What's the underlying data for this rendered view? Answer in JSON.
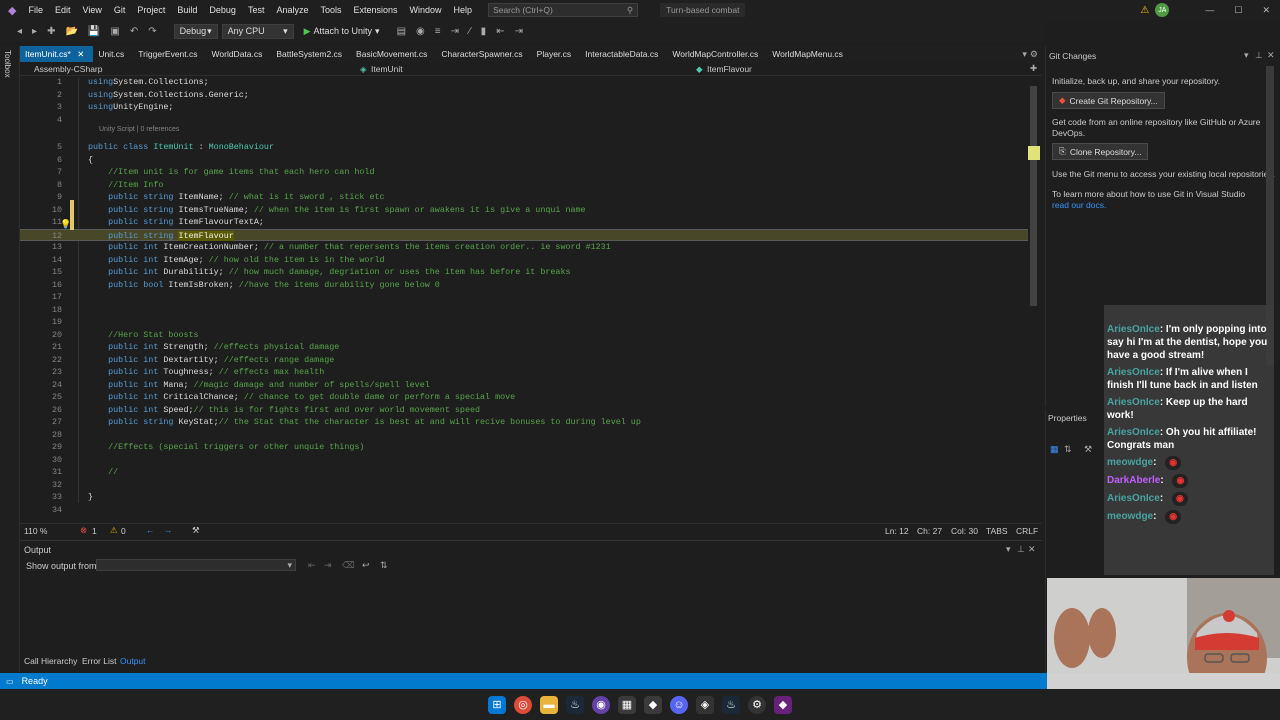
{
  "menu": [
    "File",
    "Edit",
    "View",
    "Git",
    "Project",
    "Build",
    "Debug",
    "Test",
    "Analyze",
    "Tools",
    "Extensions",
    "Window",
    "Help"
  ],
  "search": {
    "placeholder": "Search (Ctrl+Q)"
  },
  "solution_name": "Turn-based combat",
  "user_initials": "JA",
  "toolbar": {
    "config": "Debug",
    "platform": "Any CPU",
    "attach": "Attach to Unity"
  },
  "tabs": [
    "ItemUnit.cs*",
    "Unit.cs",
    "TriggerEvent.cs",
    "WorldData.cs",
    "BattleSystem2.cs",
    "BasicMovement.cs",
    "CharacterSpawner.cs",
    "Player.cs",
    "InteractableData.cs",
    "WorldMapController.cs",
    "WorldMapMenu.cs"
  ],
  "navbar": {
    "project": "Assembly-CSharp",
    "class": "ItemUnit",
    "member": "ItemFlavour"
  },
  "sidebar_label": "Toolbox",
  "codelens": "Unity Script | 0 references",
  "code": [
    {
      "n": "1",
      "t": [
        [
          "kw",
          "using"
        ],
        [
          "",
          "System.Collections;"
        ]
      ]
    },
    {
      "n": "2",
      "t": [
        [
          "kw",
          "using"
        ],
        [
          "",
          "System.Collections.Generic;"
        ]
      ]
    },
    {
      "n": "3",
      "t": [
        [
          "kw",
          "using"
        ],
        [
          "",
          "UnityEngine;"
        ]
      ]
    },
    {
      "n": "4",
      "t": []
    },
    {
      "n": "5",
      "t": [
        [
          "kw",
          "public class "
        ],
        [
          "ty",
          "ItemUnit"
        ],
        [
          "",
          " : "
        ],
        [
          "ty",
          "MonoBehaviour"
        ]
      ]
    },
    {
      "n": "6",
      "t": [
        [
          "",
          "{"
        ]
      ]
    },
    {
      "n": "7",
      "t": [
        [
          "cm",
          "    //Item unit is for game items that each hero can hold"
        ]
      ]
    },
    {
      "n": "8",
      "t": [
        [
          "cm",
          "    //Item Info"
        ]
      ]
    },
    {
      "n": "9",
      "t": [
        [
          "kw",
          "    public string "
        ],
        [
          "",
          "ItemName; "
        ],
        [
          "cm",
          "// what is it sword , stick etc"
        ]
      ]
    },
    {
      "n": "10",
      "t": [
        [
          "kw",
          "    public string "
        ],
        [
          "",
          "ItemsTrueName; "
        ],
        [
          "cm",
          "// when the item is first spawn or awakens it is give a unqui name"
        ]
      ]
    },
    {
      "n": "11",
      "t": [
        [
          "kw",
          "    public string "
        ],
        [
          "",
          "ItemFlavourTextA;"
        ]
      ]
    },
    {
      "n": "12",
      "t": [
        [
          "kw",
          "    public string "
        ],
        [
          "sel",
          "ItemFlavour"
        ]
      ]
    },
    {
      "n": "13",
      "t": [
        [
          "kw",
          "    public int "
        ],
        [
          "",
          "ItemCreationNumber; "
        ],
        [
          "cm",
          "// a number that repersents the items creation order.. ie sword #1231"
        ]
      ]
    },
    {
      "n": "14",
      "t": [
        [
          "kw",
          "    public int "
        ],
        [
          "",
          "ItemAge; "
        ],
        [
          "cm",
          "// how old the item is in the world"
        ]
      ]
    },
    {
      "n": "15",
      "t": [
        [
          "kw",
          "    public int "
        ],
        [
          "",
          "Durabilitiy; "
        ],
        [
          "cm",
          "// how much damage, degriation or uses the item has before it breaks"
        ]
      ]
    },
    {
      "n": "16",
      "t": [
        [
          "kw",
          "    public bool "
        ],
        [
          "",
          "ItemIsBroken; "
        ],
        [
          "cm",
          "//have the items durability gone below 0"
        ]
      ]
    },
    {
      "n": "17",
      "t": []
    },
    {
      "n": "18",
      "t": []
    },
    {
      "n": "19",
      "t": []
    },
    {
      "n": "20",
      "t": [
        [
          "cm",
          "    //Hero Stat boosts"
        ]
      ]
    },
    {
      "n": "21",
      "t": [
        [
          "kw",
          "    public int "
        ],
        [
          "",
          "Strength; "
        ],
        [
          "cm",
          "//effects physical damage"
        ]
      ]
    },
    {
      "n": "22",
      "t": [
        [
          "kw",
          "    public int "
        ],
        [
          "",
          "Dextartity; "
        ],
        [
          "cm",
          "//effects range damage"
        ]
      ]
    },
    {
      "n": "23",
      "t": [
        [
          "kw",
          "    public int "
        ],
        [
          "",
          "Toughness; "
        ],
        [
          "cm",
          "// effects max health"
        ]
      ]
    },
    {
      "n": "24",
      "t": [
        [
          "kw",
          "    public int "
        ],
        [
          "",
          "Mana; "
        ],
        [
          "cm",
          "//magic damage and number of spells/spell level"
        ]
      ]
    },
    {
      "n": "25",
      "t": [
        [
          "kw",
          "    public int "
        ],
        [
          "",
          "CriticalChance; "
        ],
        [
          "cm",
          "// chance to get double dame or perform a special move"
        ]
      ]
    },
    {
      "n": "26",
      "t": [
        [
          "kw",
          "    public int "
        ],
        [
          "",
          "Speed;"
        ],
        [
          "cm",
          "// this is for fights first and over world movement speed"
        ]
      ]
    },
    {
      "n": "27",
      "t": [
        [
          "kw",
          "    public string "
        ],
        [
          "",
          "KeyStat;"
        ],
        [
          "cm",
          "// the Stat that the character is best at and will recive bonuses to during level up"
        ]
      ]
    },
    {
      "n": "28",
      "t": []
    },
    {
      "n": "29",
      "t": [
        [
          "cm",
          "    //Effects (special triggers or other unquie things)"
        ]
      ]
    },
    {
      "n": "30",
      "t": []
    },
    {
      "n": "31",
      "t": [
        [
          "cm",
          "    //"
        ]
      ]
    },
    {
      "n": "32",
      "t": []
    },
    {
      "n": "33",
      "t": [
        [
          "",
          "}"
        ]
      ]
    },
    {
      "n": "34",
      "t": []
    }
  ],
  "editor_status": {
    "zoom": "110 %",
    "errors": "1",
    "warnings": "0",
    "ln": "Ln: 12",
    "ch": "Ch: 27",
    "col": "Col: 30",
    "tabs": "TABS",
    "eol": "CRLF"
  },
  "output": {
    "title": "Output",
    "show_from": "Show output from:"
  },
  "bottom_tabs": [
    "Call Hierarchy",
    "Error List",
    "Output"
  ],
  "status": "Ready",
  "git": {
    "title": "Git Changes",
    "intro": "Initialize, back up, and share your repository.",
    "create": "Create Git Repository...",
    "get_code": "Get code from an online repository like GitHub or Azure DevOps.",
    "clone": "Clone Repository...",
    "use_menu": "Use the Git menu to access your existing local repositories.",
    "learn": "To learn more about how to use Git in Visual Studio",
    "read_docs": "read our docs."
  },
  "properties": {
    "title": "Properties"
  },
  "chat": [
    {
      "user": "AriesOnIce",
      "msg": "I'm only popping into say hi I'm at the dentist, hope you have a good stream!"
    },
    {
      "user": "AriesOnIce",
      "msg": "If I'm alive when I finish I'll tune back in and listen"
    },
    {
      "user": "AriesOnIce",
      "msg": "Keep up the hard work!"
    },
    {
      "user": "AriesOnIce",
      "msg": "Oh you hit affiliate! Congrats man"
    },
    {
      "user": "meowdge",
      "msg": ""
    },
    {
      "user": "DarkAberle",
      "msg": ""
    },
    {
      "user": "AriesOnIce",
      "msg": ""
    },
    {
      "user": "meowdge",
      "msg": ""
    }
  ]
}
